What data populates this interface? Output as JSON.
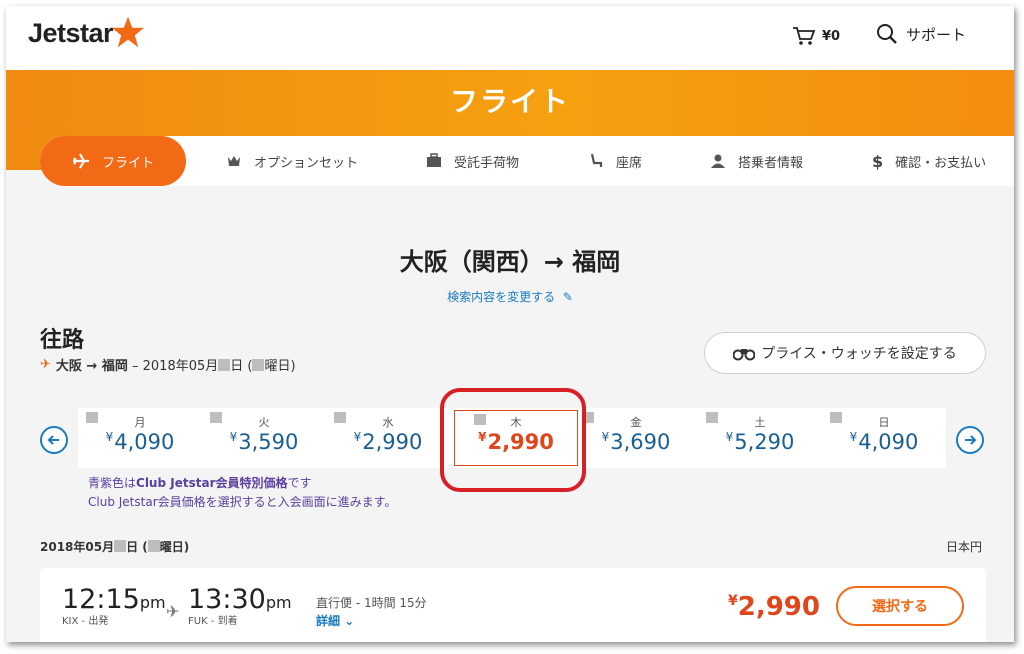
{
  "header": {
    "logo_text": "Jetstar",
    "cart_amount": "¥0",
    "support_label": "サポート"
  },
  "band": {
    "title": "フライト"
  },
  "steps": [
    {
      "label": "フライト",
      "icon": "plane-icon",
      "active": true
    },
    {
      "label": "オプションセット",
      "icon": "crown-icon"
    },
    {
      "label": "受託手荷物",
      "icon": "baggage-icon"
    },
    {
      "label": "座席",
      "icon": "seat-icon"
    },
    {
      "label": "搭乗者情報",
      "icon": "person-icon"
    },
    {
      "label": "確認・お支払い",
      "icon": "dollar-icon"
    }
  ],
  "route": {
    "title": "大阪（関西）→ 福岡",
    "modify_label": "検索内容を変更する"
  },
  "outbound": {
    "section_title": "往路",
    "leg_route": "大阪 → 福岡",
    "leg_date_prefix": "– 2018年05月",
    "leg_date_mid": "日 (",
    "leg_date_suffix": "曜日)",
    "price_watch_label": "プライス・ウォッチを設定する"
  },
  "dates": [
    {
      "day": "月",
      "yen": "¥",
      "price": "4,090",
      "selected": false
    },
    {
      "day": "火",
      "yen": "¥",
      "price": "3,590",
      "selected": false
    },
    {
      "day": "水",
      "yen": "¥",
      "price": "2,990",
      "selected": false
    },
    {
      "day": "木",
      "yen": "¥",
      "price": "2,990",
      "selected": true
    },
    {
      "day": "金",
      "yen": "¥",
      "price": "3,690",
      "selected": false
    },
    {
      "day": "土",
      "yen": "¥",
      "price": "5,290",
      "selected": false
    },
    {
      "day": "日",
      "yen": "¥",
      "price": "4,090",
      "selected": false
    }
  ],
  "notes": {
    "line1_prefix": "青紫色は",
    "line1_bold": "Club Jetstar会員特別価格",
    "line1_suffix": "です",
    "line2": "Club Jetstar会員価格を選択すると入会画面に進みます。"
  },
  "results": {
    "date_prefix": "2018年05月",
    "date_mid": "日 (",
    "date_suffix": "曜日)",
    "currency": "日本円"
  },
  "flight": {
    "depart_time": "12:15",
    "depart_ampm": "pm",
    "depart_sub": "KIX - 出発",
    "arrive_time": "13:30",
    "arrive_ampm": "pm",
    "arrive_sub": "FUK - 到着",
    "info": "直行便 - 1時間 15分",
    "detail_label": "詳細",
    "fare_yen": "¥",
    "fare": "2,990",
    "select_label": "選択する"
  },
  "colors": {
    "brand_orange": "#f26a16",
    "link_blue": "#1a7bc0",
    "member_purple": "#5a3f9e",
    "fare_red": "#e0461c",
    "highlight_ring": "#d81f26"
  }
}
